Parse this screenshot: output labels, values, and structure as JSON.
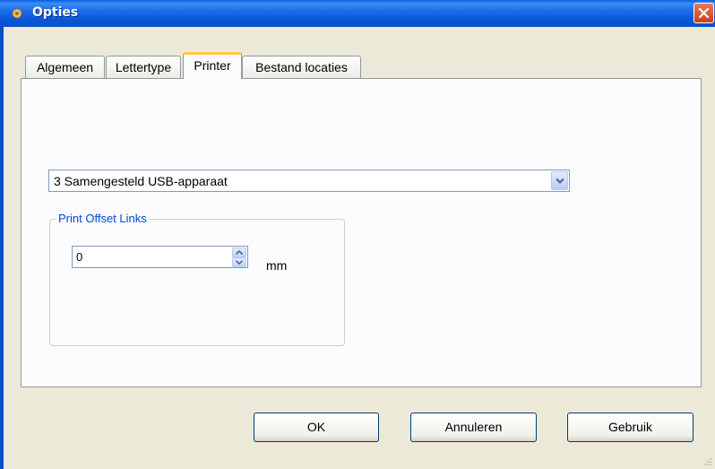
{
  "window": {
    "title": "Opties",
    "icon": "gear-icon",
    "close_icon": "close-icon"
  },
  "tabs": [
    {
      "label": "Algemeen",
      "active": false
    },
    {
      "label": "Lettertype",
      "active": false
    },
    {
      "label": "Printer",
      "active": true
    },
    {
      "label": "Bestand locaties",
      "active": false
    }
  ],
  "printer": {
    "selected_printer": "3 Samengesteld USB-apparaat",
    "group_title": "Print Offset Links",
    "offset_value": "0",
    "offset_unit": "mm"
  },
  "buttons": {
    "ok": "OK",
    "cancel": "Annuleren",
    "apply": "Gebruik"
  },
  "colors": {
    "titlebar": "#0B57D9",
    "active_tab_accent": "#FFC83C",
    "group_label": "#0046D5",
    "dialog_bg": "#ECE9D8"
  }
}
